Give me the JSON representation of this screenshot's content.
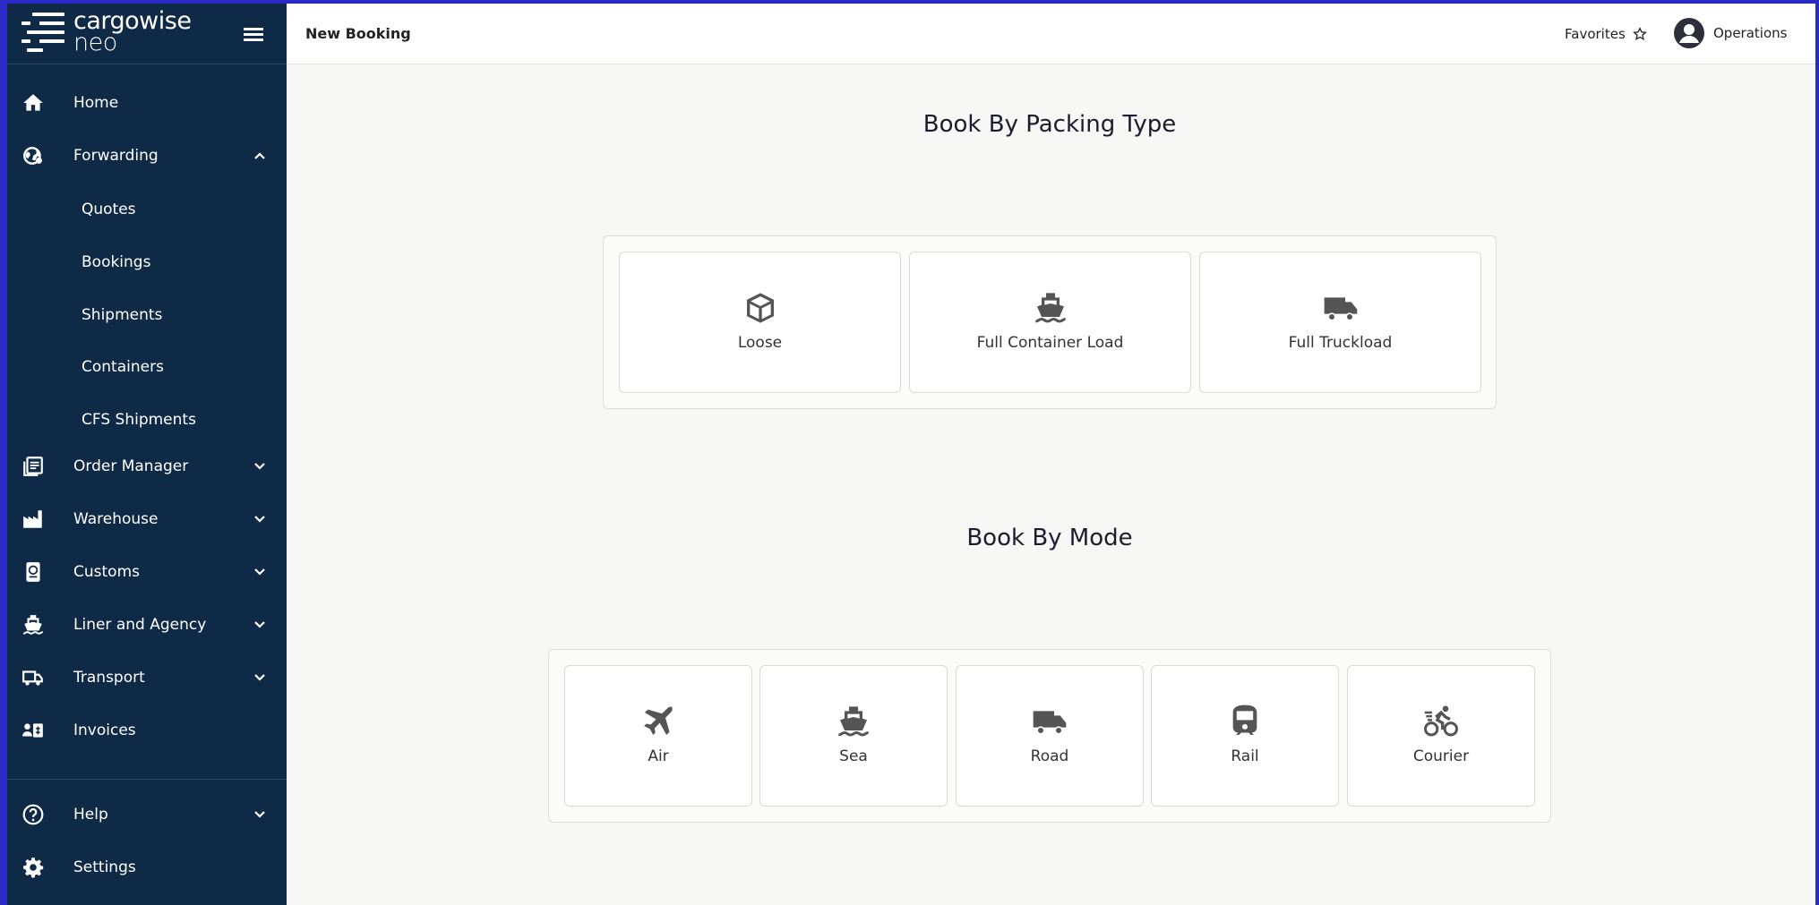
{
  "brand": {
    "line1": "cargowise",
    "line2": "neo"
  },
  "sidebar": {
    "items": [
      {
        "label": "Home",
        "icon": "home-icon"
      },
      {
        "label": "Forwarding",
        "icon": "globe-icon",
        "expanded": true,
        "children": [
          "Quotes",
          "Bookings",
          "Shipments",
          "Containers",
          "CFS Shipments"
        ]
      },
      {
        "label": "Order Manager",
        "icon": "orders-icon"
      },
      {
        "label": "Warehouse",
        "icon": "warehouse-icon"
      },
      {
        "label": "Customs",
        "icon": "passport-icon"
      },
      {
        "label": "Liner and Agency",
        "icon": "ship-icon"
      },
      {
        "label": "Transport",
        "icon": "truck-icon"
      },
      {
        "label": "Invoices",
        "icon": "invoice-icon"
      }
    ],
    "bottom": [
      {
        "label": "Help",
        "icon": "help-icon"
      },
      {
        "label": "Settings",
        "icon": "gear-icon"
      }
    ]
  },
  "topbar": {
    "title": "New Booking",
    "favorites_label": "Favorites",
    "user_label": "Operations"
  },
  "packing": {
    "title": "Book By Packing Type",
    "cards": [
      {
        "label": "Loose",
        "icon": "box-icon"
      },
      {
        "label": "Full Container Load",
        "icon": "ship-icon"
      },
      {
        "label": "Full Truckload",
        "icon": "truck-icon"
      }
    ]
  },
  "mode": {
    "title": "Book By Mode",
    "cards": [
      {
        "label": "Air",
        "icon": "plane-icon"
      },
      {
        "label": "Sea",
        "icon": "ship-icon"
      },
      {
        "label": "Road",
        "icon": "truck-icon"
      },
      {
        "label": "Rail",
        "icon": "train-icon"
      },
      {
        "label": "Courier",
        "icon": "bicycle-icon"
      }
    ]
  },
  "colors": {
    "sidebar_bg": "#0f2a47",
    "frame_border": "#2a2ac8",
    "icon_gray": "#555555"
  }
}
